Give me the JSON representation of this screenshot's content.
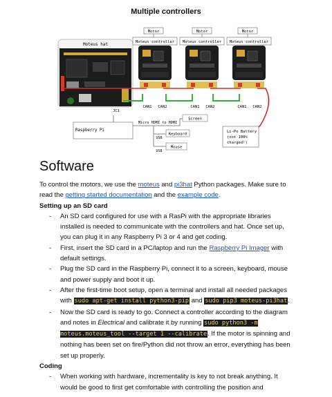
{
  "figure": {
    "title": "Multiple controllers",
    "hat_label": "Moteus hat",
    "motor_label": "Motor",
    "controller_label": "Moteus controller",
    "can1": "CAN1",
    "can2": "CAN2",
    "jc1": "JC1",
    "rpi_label": "Raspberry Pi",
    "hdmi_label": "Micro HDMI to HDMI",
    "screen_label": "Screen",
    "usb_label": "USB",
    "keyboard_label": "Keyboard",
    "mouse_label": "Mouse",
    "battery_label": "Li-Po Battery (not 100% charged!)",
    "battery_lines": [
      "Li-Po Battery",
      "(not 100%",
      "charged!)"
    ]
  },
  "doc": {
    "heading": "Software",
    "intro": {
      "t1": "To control the motors, we use the ",
      "link1": "moteus",
      "t2": " and ",
      "link2": "pi3hat",
      "t3": " Python packages. Make sure to read the ",
      "link3": "getting started documentation",
      "t4": " and the ",
      "link4": "example code",
      "t5": "."
    },
    "sd_heading": "Setting up an SD card",
    "sd_items": {
      "i1": "An SD card configured for use with a RasPi with the appropriate libraries installed is needed to communicate with the controllers and hat. Once set up, you can plug it in any Raspberry Pi 3 or 4 and get coding.",
      "i2a": "First, insert the SD card in a PC/laptop and run the ",
      "i2link": "Raspberry Pi Imager",
      "i2b": " with default settings.",
      "i3": "Plug the SD card in the Raspberry Pi, connect it to a screen, keyboard, mouse and power supply and boot it up.",
      "i4a": "After the first-time boot setup, open a terminal and install all needed packages with ",
      "i4code1": "sudo apt-get install python3-pip",
      "i4b": " and ",
      "i4code2": "sudo pip3 moteus-pi3hat",
      "i4c": ".",
      "i5a": "Now the SD card is ready to go. Connect a controller according to the diagram and notes in ",
      "i5em": "Electrical",
      "i5b": " and calibrate it by running ",
      "i5code": "sudo python3 -m moteus.moteus_tool --target 1 --calibrate",
      "i5c": ". If the motor is spinning and nothing has been set on fire/Python did not throw an error, everything has been set up properly."
    },
    "coding_heading": "Coding",
    "coding_items": {
      "c1": "When working with hardware, incrementality is key to not break anything. It would be good to first get comfortable with controlling the position and"
    }
  }
}
